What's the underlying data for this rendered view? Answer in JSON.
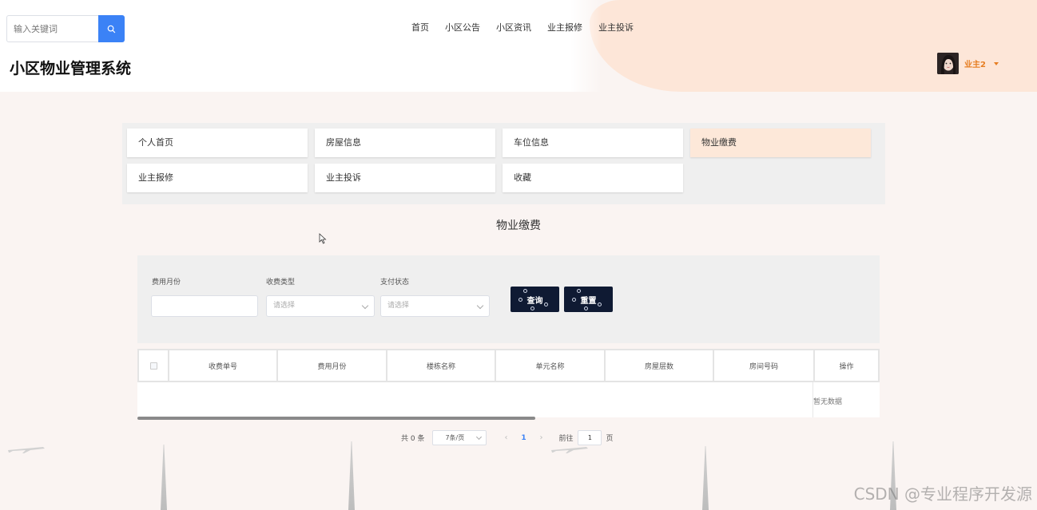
{
  "header": {
    "search_placeholder": "输入关键词",
    "site_title": "小区物业管理系统",
    "nav": [
      "首页",
      "小区公告",
      "小区资讯",
      "业主报修",
      "业主投诉"
    ],
    "user_name": "业主2"
  },
  "menu": {
    "items": [
      "个人首页",
      "房屋信息",
      "车位信息",
      "物业缴费",
      "业主报修",
      "业主投诉",
      "收藏"
    ],
    "active": "物业缴费"
  },
  "page": {
    "title": "物业缴费"
  },
  "filters": {
    "month_label": "费用月份",
    "fee_type_label": "收费类型",
    "fee_type_placeholder": "请选择",
    "pay_status_label": "支付状态",
    "pay_status_placeholder": "请选择",
    "query_button": "查询",
    "reset_button": "重置"
  },
  "table": {
    "columns": [
      "收费单号",
      "费用月份",
      "楼栋名称",
      "单元名称",
      "房屋层数",
      "房间号码",
      "操作"
    ],
    "empty_text": "暂无数据"
  },
  "pagination": {
    "total_text": "共 0 条",
    "page_size": "7条/页",
    "current_page": "1",
    "goto_label": "前往",
    "goto_value": "1",
    "page_suffix": "页"
  },
  "watermark": "CSDN @专业程序开发源",
  "colors": {
    "accent_blue": "#3b82f6",
    "user_orange": "#e67e22",
    "active_menu_bg": "#fde8d9",
    "dark_button": "#0f1a33"
  }
}
